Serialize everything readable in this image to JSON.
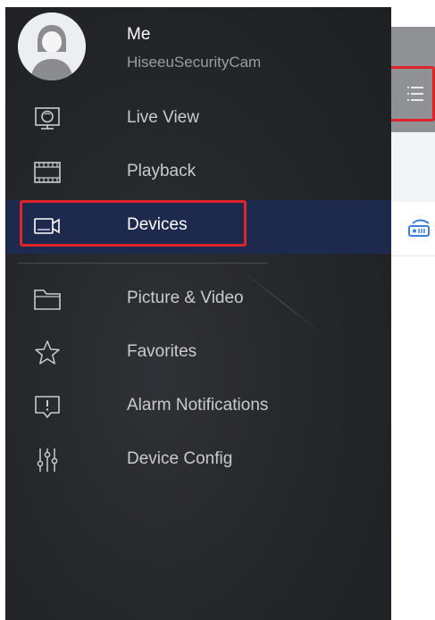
{
  "profile": {
    "name": "Me",
    "app_name": "HiseeuSecurityCam"
  },
  "menu": {
    "items": [
      {
        "label": "Live View",
        "icon": "monitor-icon"
      },
      {
        "label": "Playback",
        "icon": "film-icon"
      },
      {
        "label": "Devices",
        "icon": "camera-icon",
        "active": true
      },
      {
        "label": "Picture & Video",
        "icon": "folder-icon"
      },
      {
        "label": "Favorites",
        "icon": "star-icon"
      },
      {
        "label": "Alarm Notifications",
        "icon": "alert-icon"
      },
      {
        "label": "Device Config",
        "icon": "sliders-icon"
      }
    ]
  },
  "colors": {
    "drawer_bg": "#25272a",
    "active_row": "#1e2a4d",
    "highlight": "#e0242b",
    "device_accent": "#3d7fe0"
  }
}
